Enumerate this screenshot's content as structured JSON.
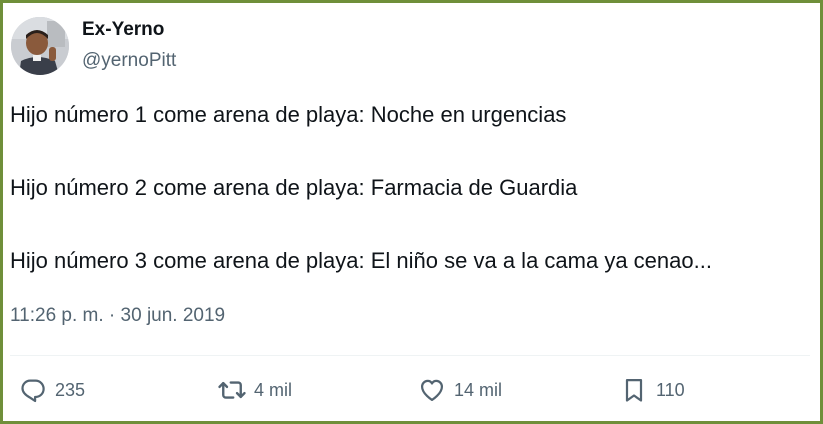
{
  "author": {
    "display_name": "Ex-Yerno",
    "handle": "@yernoPitt"
  },
  "tweet": {
    "lines": [
      "Hijo número 1 come arena de playa: Noche en urgencias",
      "Hijo número 2 come arena de playa: Farmacia de Guardia",
      "Hijo número 3 come arena de playa: El niño se va a la cama ya cenao..."
    ],
    "timestamp": "11:26 p. m. · 30 jun. 2019"
  },
  "actions": {
    "reply": {
      "icon": "reply-icon",
      "count": "235"
    },
    "retweet": {
      "icon": "retweet-icon",
      "count": "4 mil"
    },
    "like": {
      "icon": "heart-icon",
      "count": "14 mil"
    },
    "bookmark": {
      "icon": "bookmark-icon",
      "count": "110"
    }
  },
  "colors": {
    "frame_border": "#6f8f3a",
    "text_primary": "#0f1419",
    "text_secondary": "#536471",
    "divider": "#eff3f4"
  }
}
